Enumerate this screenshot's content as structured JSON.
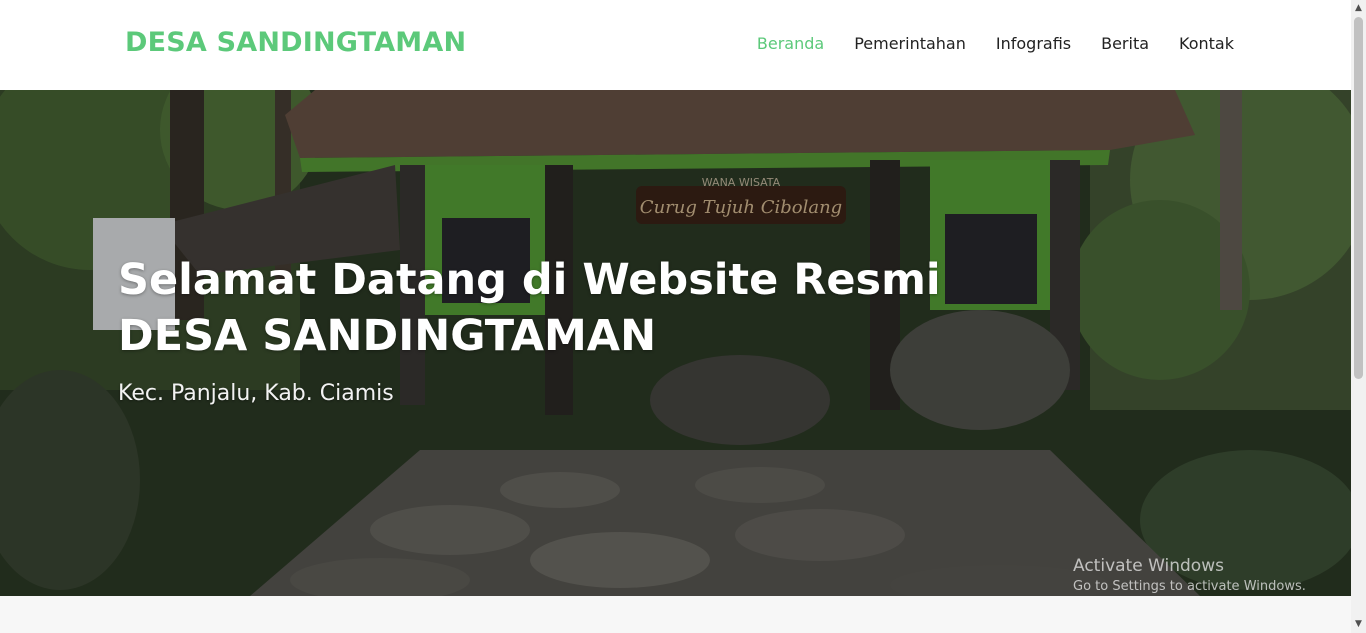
{
  "brand": {
    "name": "DESA SANDINGTAMAN"
  },
  "nav": {
    "items": [
      {
        "label": "Beranda",
        "active": true
      },
      {
        "label": "Pemerintahan",
        "active": false
      },
      {
        "label": "Infografis",
        "active": false
      },
      {
        "label": "Berita",
        "active": false
      },
      {
        "label": "Kontak",
        "active": false
      }
    ]
  },
  "hero": {
    "title_line1": "Selamat Datang di Website Resmi",
    "title_line2": "DESA SANDINGTAMAN",
    "subtitle": "Kec. Panjalu, Kab. Ciamis",
    "sign_text": "Curug Tujuh Cibolang",
    "sign_subtext": "WANA WISATA"
  },
  "watermark": {
    "line1": "Activate Windows",
    "line2": "Go to Settings to activate Windows."
  },
  "colors": {
    "accent": "#5cc97a",
    "nav_text": "#222222",
    "hero_text": "#ffffff"
  }
}
